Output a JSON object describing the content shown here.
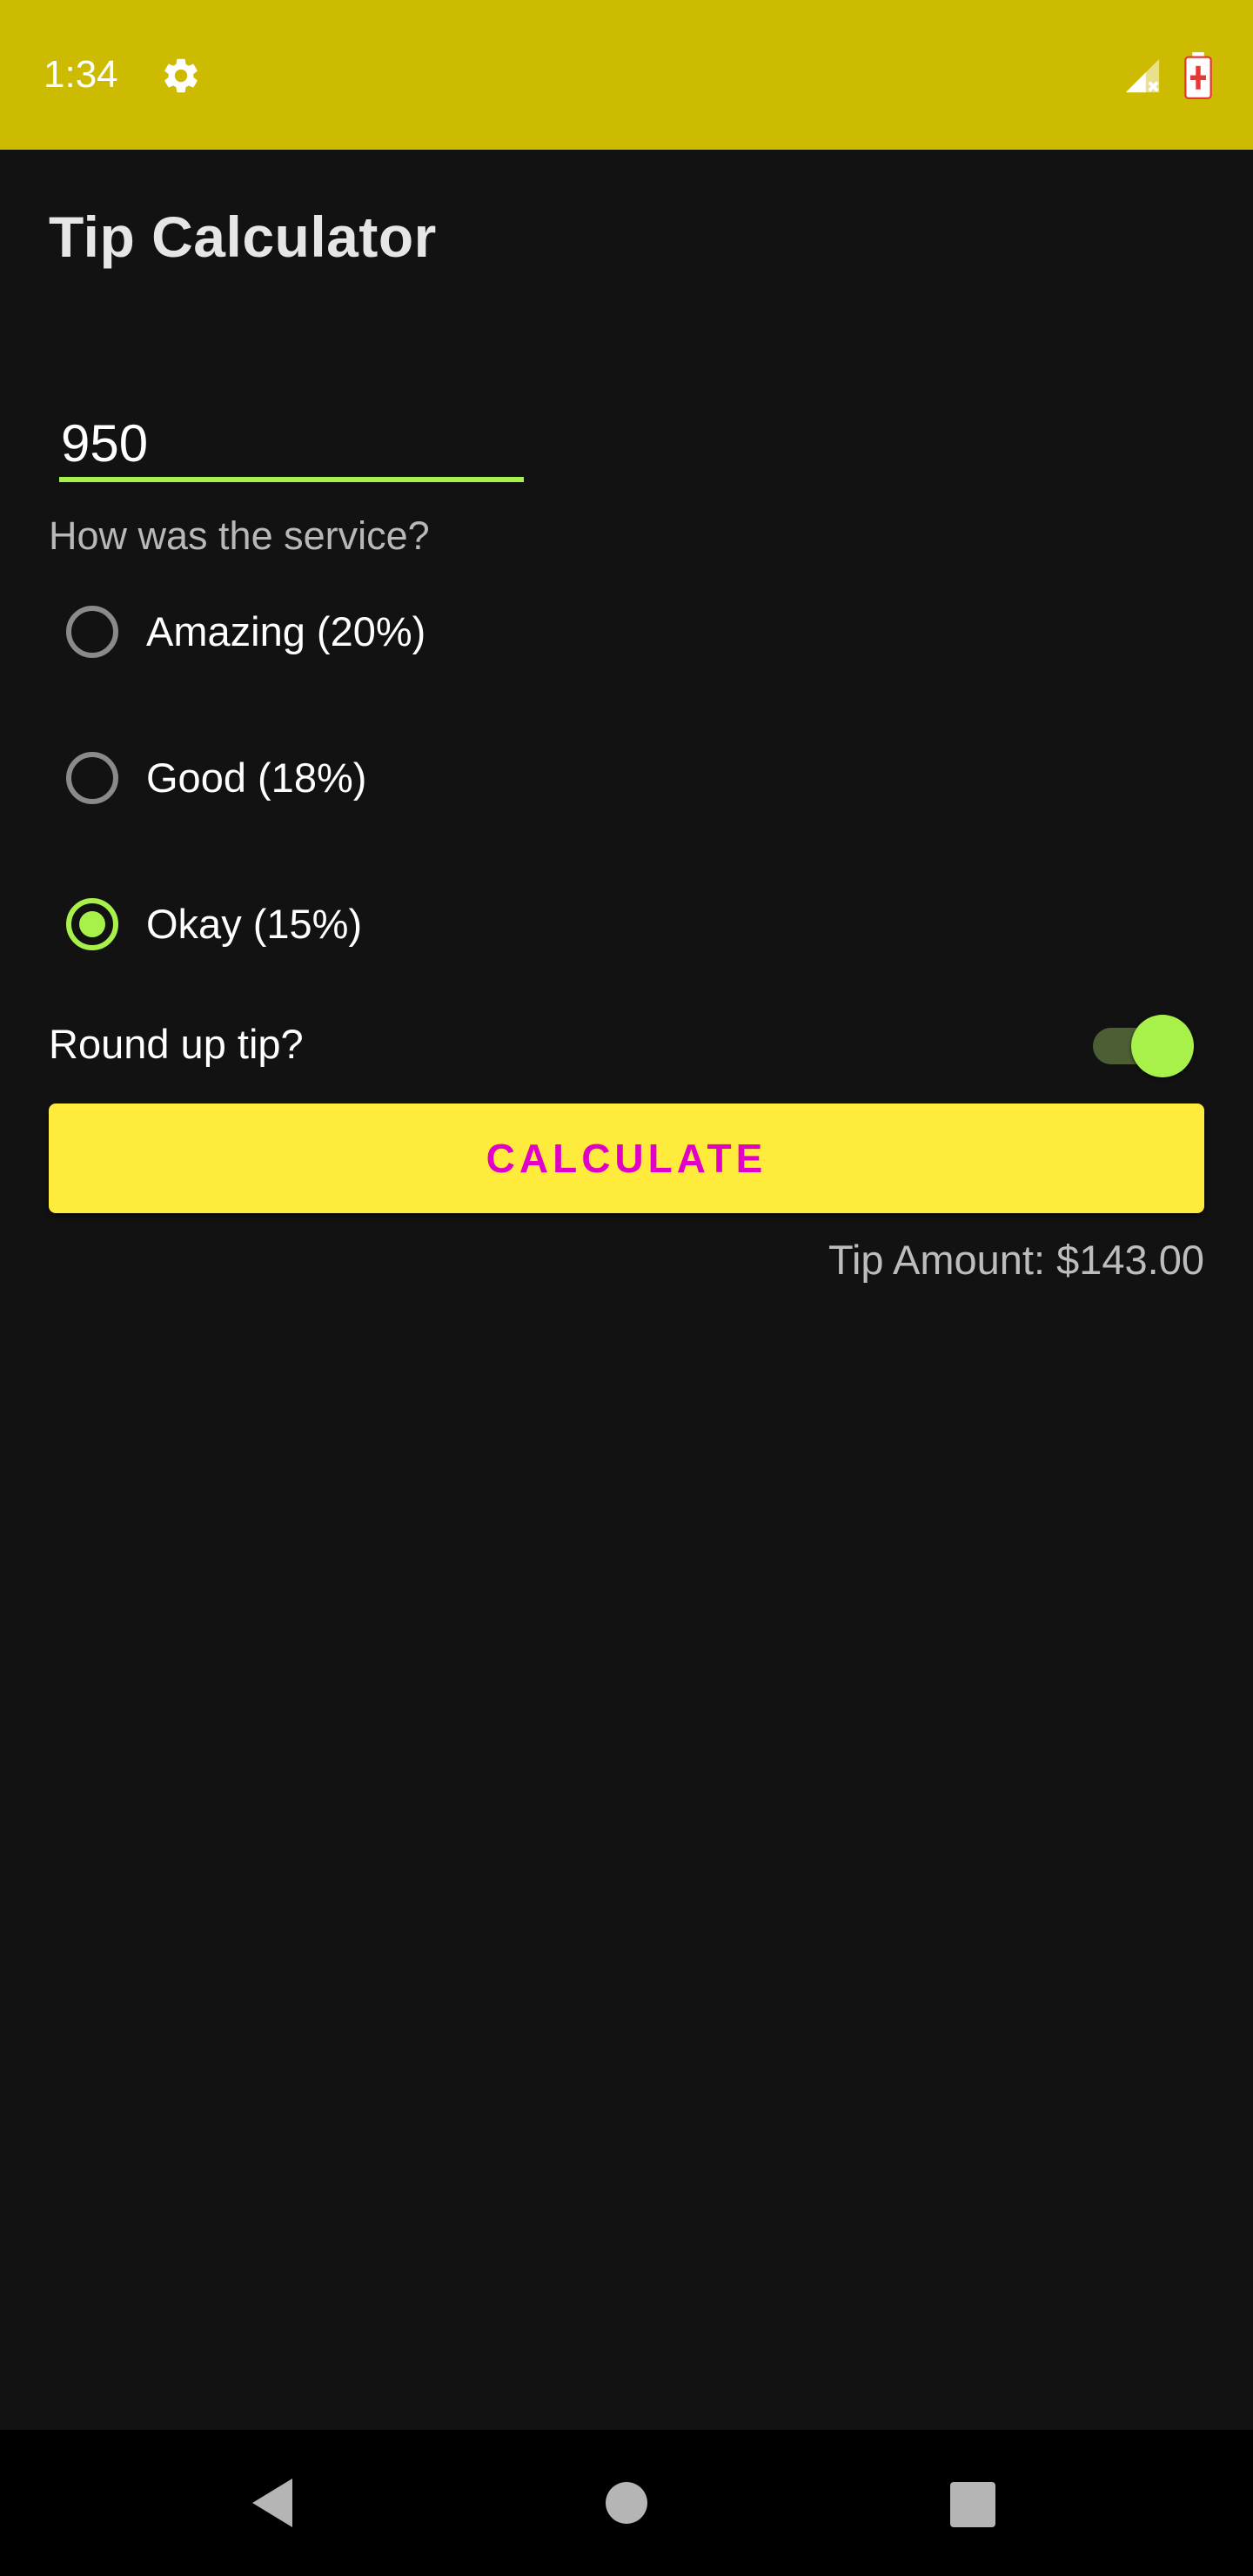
{
  "status_bar": {
    "time": "1:34",
    "icons": [
      "settings-gear-icon",
      "signal-no-service-icon",
      "battery-charging-icon"
    ],
    "background": "#ccbb00"
  },
  "app": {
    "title": "Tip Calculator"
  },
  "form": {
    "cost_value": "950",
    "service_question": "How was the service?",
    "service_options": [
      {
        "label": "Amazing (20%)",
        "selected": false
      },
      {
        "label": "Good (18%)",
        "selected": false
      },
      {
        "label": "Okay (15%)",
        "selected": true
      }
    ],
    "round_up_label": "Round up tip?",
    "round_up_enabled": true,
    "calculate_label": "CALCULATE",
    "tip_result": "Tip Amount: $143.00"
  },
  "nav_bar": {
    "icons": [
      "back-icon",
      "home-icon",
      "recents-icon"
    ]
  },
  "colors": {
    "background": "#121212",
    "accent": "#a8f04a",
    "button": "#ffeb3b",
    "button_text": "#e000c8"
  }
}
